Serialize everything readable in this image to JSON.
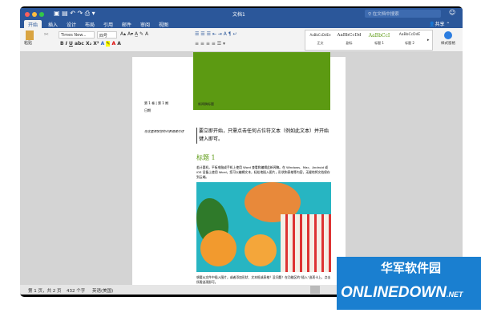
{
  "window": {
    "title": "文档1",
    "search_placeholder": "在文档中搜索",
    "share": "共享"
  },
  "tabs": [
    "开始",
    "插入",
    "设计",
    "布局",
    "引用",
    "邮件",
    "审阅",
    "视图"
  ],
  "ribbon": {
    "paste": "粘贴",
    "font": "Times New...",
    "size": "四号",
    "styles": [
      {
        "preview": "AaBbCcDdEe",
        "name": "正文"
      },
      {
        "preview": "AaBbCcDd",
        "name": "副标"
      },
      {
        "preview": "AaBbCcI",
        "name": "标题 1"
      },
      {
        "preview": "AaBbCcDdE",
        "name": "标题 2"
      }
    ],
    "styles_pane": "样式窗格"
  },
  "page": {
    "header_left1": "第 1 卷 | 第 1 期",
    "header_left2": "日期",
    "green_caption": "新闻稿标题",
    "side_note": "在这里添加您的代表语或引述",
    "intro": "要立即开始，只需点击任何占位符文本（例如此文本）并开始键入即可。",
    "heading": "标题 1",
    "body": "若计要机，平板电脑或手机上使用 Word 查看和编辑此新闻稿。在 Windows、Mac、Android 或 iOS 设备上使用 Word，您可以编辑文本，轻松地插入图片，形状和表格等内容，无缝地将文档保存到云端。",
    "bottom": "想要从文件中插入图片，或者添加形状、文本框或表格？没问题！在功能区的“插入”选项卡上，点击所需选项即可。"
  },
  "status": {
    "page": "第 1 页，共 2 页",
    "words": "432 个字",
    "lang": "英语(美国)"
  },
  "watermark": {
    "cn": "华军软件园",
    "en": "ONLINEDOWN",
    "net": ".NET"
  },
  "colors": {
    "accent": "#2b579a",
    "green": "#5c9a12"
  }
}
